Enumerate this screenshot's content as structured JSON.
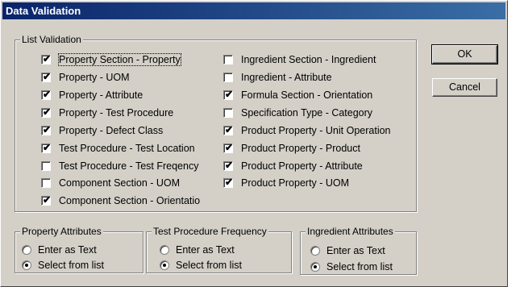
{
  "window": {
    "title": "Data Validation"
  },
  "list_validation": {
    "label": "List Validation",
    "left_items": [
      {
        "label": "Property Section - Property",
        "checked": true
      },
      {
        "label": "Property - UOM",
        "checked": true
      },
      {
        "label": "Property - Attribute",
        "checked": true
      },
      {
        "label": "Property - Test Procedure",
        "checked": true
      },
      {
        "label": "Property - Defect Class",
        "checked": true
      },
      {
        "label": "Test Procedure - Test Location",
        "checked": true
      },
      {
        "label": "Test Procedure - Test Freqency",
        "checked": false
      },
      {
        "label": "Component Section - UOM",
        "checked": false
      },
      {
        "label": "Component Section - Orientatio",
        "checked": true
      }
    ],
    "right_items": [
      {
        "label": "Ingredient Section - Ingredient",
        "checked": false
      },
      {
        "label": "Ingredient - Attribute",
        "checked": false
      },
      {
        "label": "Formula Section - Orientation",
        "checked": true
      },
      {
        "label": "Specification Type - Category",
        "checked": false
      },
      {
        "label": "Product Property - Unit Operation",
        "checked": true
      },
      {
        "label": "Product Property - Product",
        "checked": true
      },
      {
        "label": "Product Property - Attribute",
        "checked": true
      },
      {
        "label": "Product Property - UOM",
        "checked": true
      }
    ]
  },
  "groups": [
    {
      "label": "Property Attributes",
      "options": [
        "Enter as Text",
        "Select from list"
      ],
      "selected": 1
    },
    {
      "label": "Test Procedure Frequency",
      "options": [
        "Enter as Text",
        "Select from list"
      ],
      "selected": 1
    },
    {
      "label": "Ingredient Attributes",
      "options": [
        "Enter as Text",
        "Select from list"
      ],
      "selected": 1
    }
  ],
  "buttons": {
    "ok": "OK",
    "cancel": "Cancel"
  },
  "icons": {
    "checkmark": "check-icon",
    "radio": "radio-dot-icon"
  }
}
